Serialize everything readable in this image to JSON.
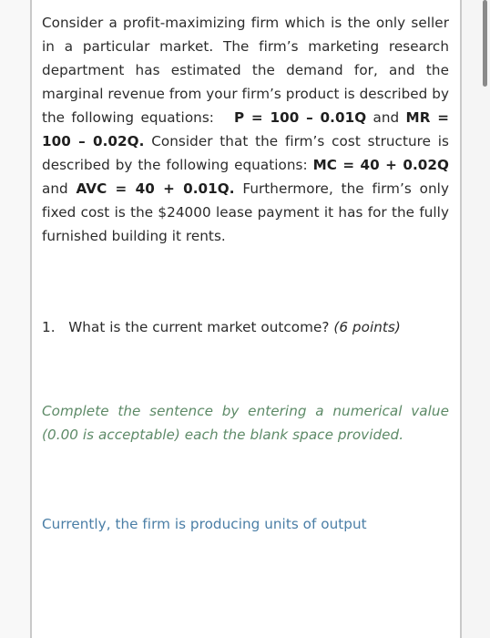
{
  "document": {
    "intro": {
      "segments": [
        {
          "text": "Consider a profit-maximizing firm which is the only seller in a particular market.  The firm’s marketing research department has estimated the demand for, and the marginal revenue from your firm’s product is described by the following equations:",
          "style": "normal"
        },
        {
          "text": "   ",
          "style": "gap"
        },
        {
          "text": "P = 100 – 0.01Q",
          "style": "bold"
        },
        {
          "text": " and ",
          "style": "normal"
        },
        {
          "text": "MR = 100 – 0.02Q.",
          "style": "bold"
        },
        {
          "text": "  Consider that the firm’s cost structure is described by the following equations:  ",
          "style": "normal"
        },
        {
          "text": "MC = 40 + 0.02Q",
          "style": "bold"
        },
        {
          "text": " and ",
          "style": "normal"
        },
        {
          "text": "AVC = 40 + 0.01Q.",
          "style": "bold"
        },
        {
          "text": "  Furthermore, the firm’s only fixed cost is the $24000 lease payment it has for the fully furnished building it rents.",
          "style": "normal"
        }
      ]
    },
    "question": {
      "number": "1.",
      "gap": "   ",
      "text": "What is the current market outcome?",
      "points": " (6 points)"
    },
    "instruction": {
      "text": "Complete the sentence by entering a numerical value (0.00 is acceptable) each the blank space provided."
    },
    "answer": {
      "text": "Currently, the firm is producing units of output"
    }
  },
  "scrollbar": {
    "orientation": "vertical",
    "position": "top"
  },
  "colors": {
    "body_text": "#2b2b2b",
    "instruction_green": "#5d8a67",
    "answer_blue": "#4a7ea6",
    "page_background": "#ffffff",
    "gutter_background": "#f5f5f5",
    "rule": "#c9c9c9",
    "scroll_thumb": "#8a8a8a"
  }
}
